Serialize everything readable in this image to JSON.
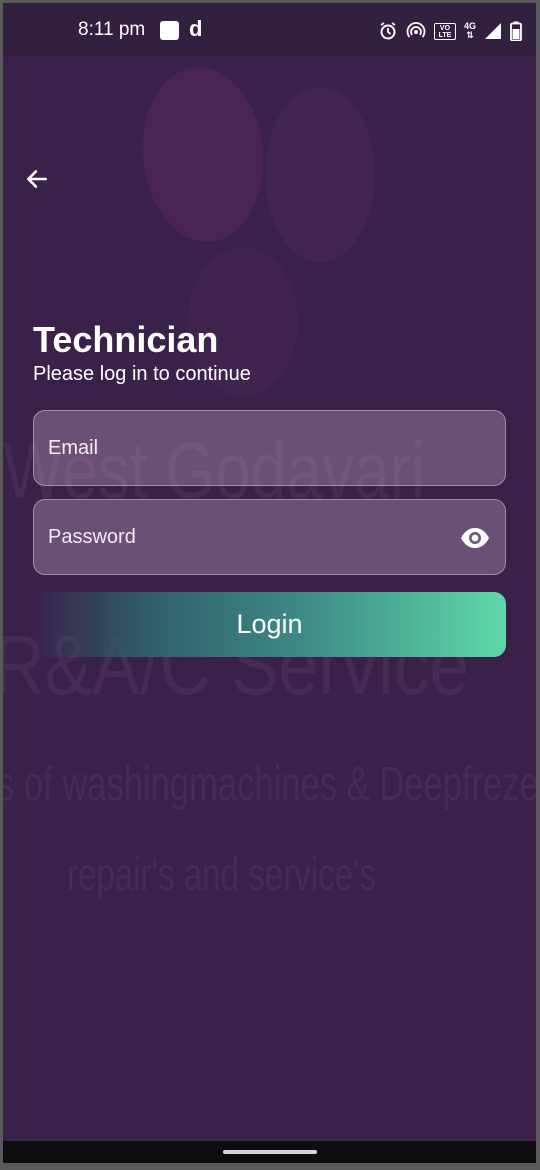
{
  "status_bar": {
    "time": "8:11 pm",
    "vo_label": "VO LTE",
    "network_label": "4G"
  },
  "watermark": {
    "line1": "West Godavari",
    "line2": "R&A/C Service",
    "line3": "s of washingmachines & Deepfreze",
    "line4": "repair's and service's"
  },
  "header": {
    "back_icon": "arrow-left-icon"
  },
  "login": {
    "title": "Technician",
    "subtitle": "Please log in to continue",
    "email_placeholder": "Email",
    "email_value": "",
    "password_placeholder": "Password",
    "password_value": "",
    "password_toggle_icon": "eye-icon",
    "button_label": "Login"
  },
  "colors": {
    "background": "#3a2149",
    "accent_start": "#2f5f6c",
    "accent_end": "#5fd8a8"
  }
}
